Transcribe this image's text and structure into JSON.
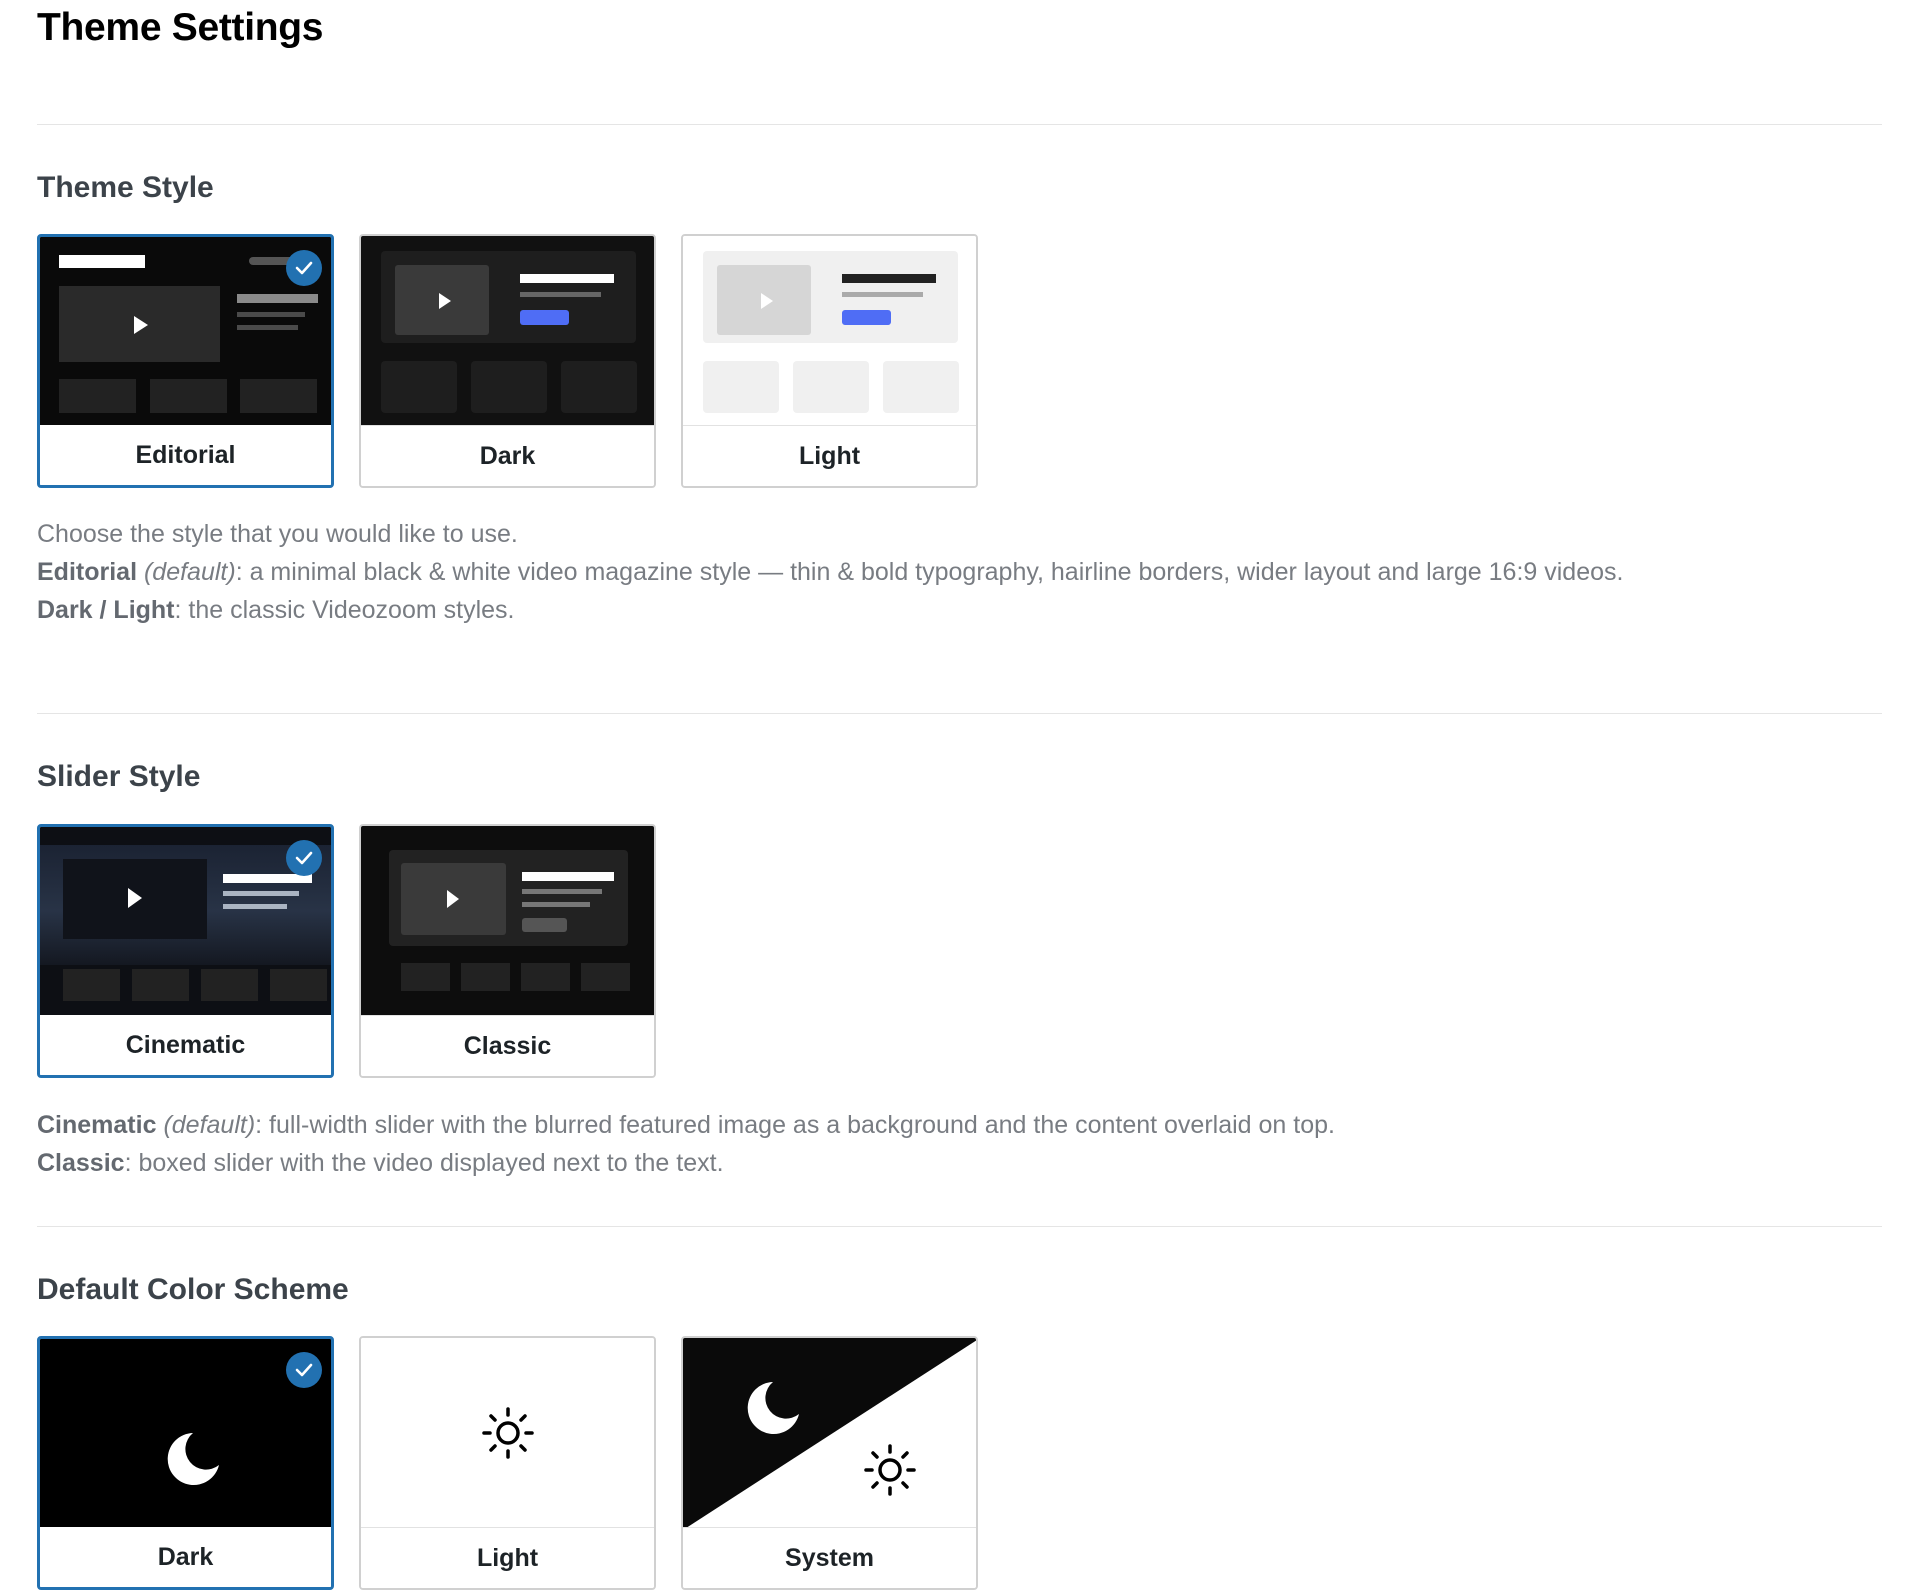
{
  "page": {
    "title": "Theme Settings"
  },
  "theme_style": {
    "title": "Theme Style",
    "options": [
      {
        "label": "Editorial",
        "selected": true
      },
      {
        "label": "Dark",
        "selected": false
      },
      {
        "label": "Light",
        "selected": false
      }
    ],
    "description": {
      "intro": "Choose the style that you would like to use.",
      "editorial_name": "Editorial",
      "editorial_default": "(default)",
      "editorial_text": ": a minimal black & white video magazine style — thin & bold typography, hairline borders, wider layout and large 16:9 videos.",
      "classic_name": "Dark / Light",
      "classic_text": ": the classic Videozoom styles."
    }
  },
  "slider_style": {
    "title": "Slider Style",
    "options": [
      {
        "label": "Cinematic",
        "selected": true
      },
      {
        "label": "Classic",
        "selected": false
      }
    ],
    "description": {
      "cinematic_name": "Cinematic",
      "cinematic_default": "(default)",
      "cinematic_text": ": full-width slider with the blurred featured image as a background and the content overlaid on top.",
      "classic_name": "Classic",
      "classic_text": ": boxed slider with the video displayed next to the text."
    }
  },
  "color_scheme": {
    "title": "Default Color Scheme",
    "options": [
      {
        "label": "Dark",
        "selected": true,
        "icon": "moon-icon"
      },
      {
        "label": "Light",
        "selected": false,
        "icon": "sun-icon"
      },
      {
        "label": "System",
        "selected": false,
        "icon": "moon-sun-icon"
      }
    ]
  },
  "colors": {
    "accent": "#2271b1",
    "preview_blue": "#4f6df5",
    "dark_bg": "#0a0a0a"
  }
}
